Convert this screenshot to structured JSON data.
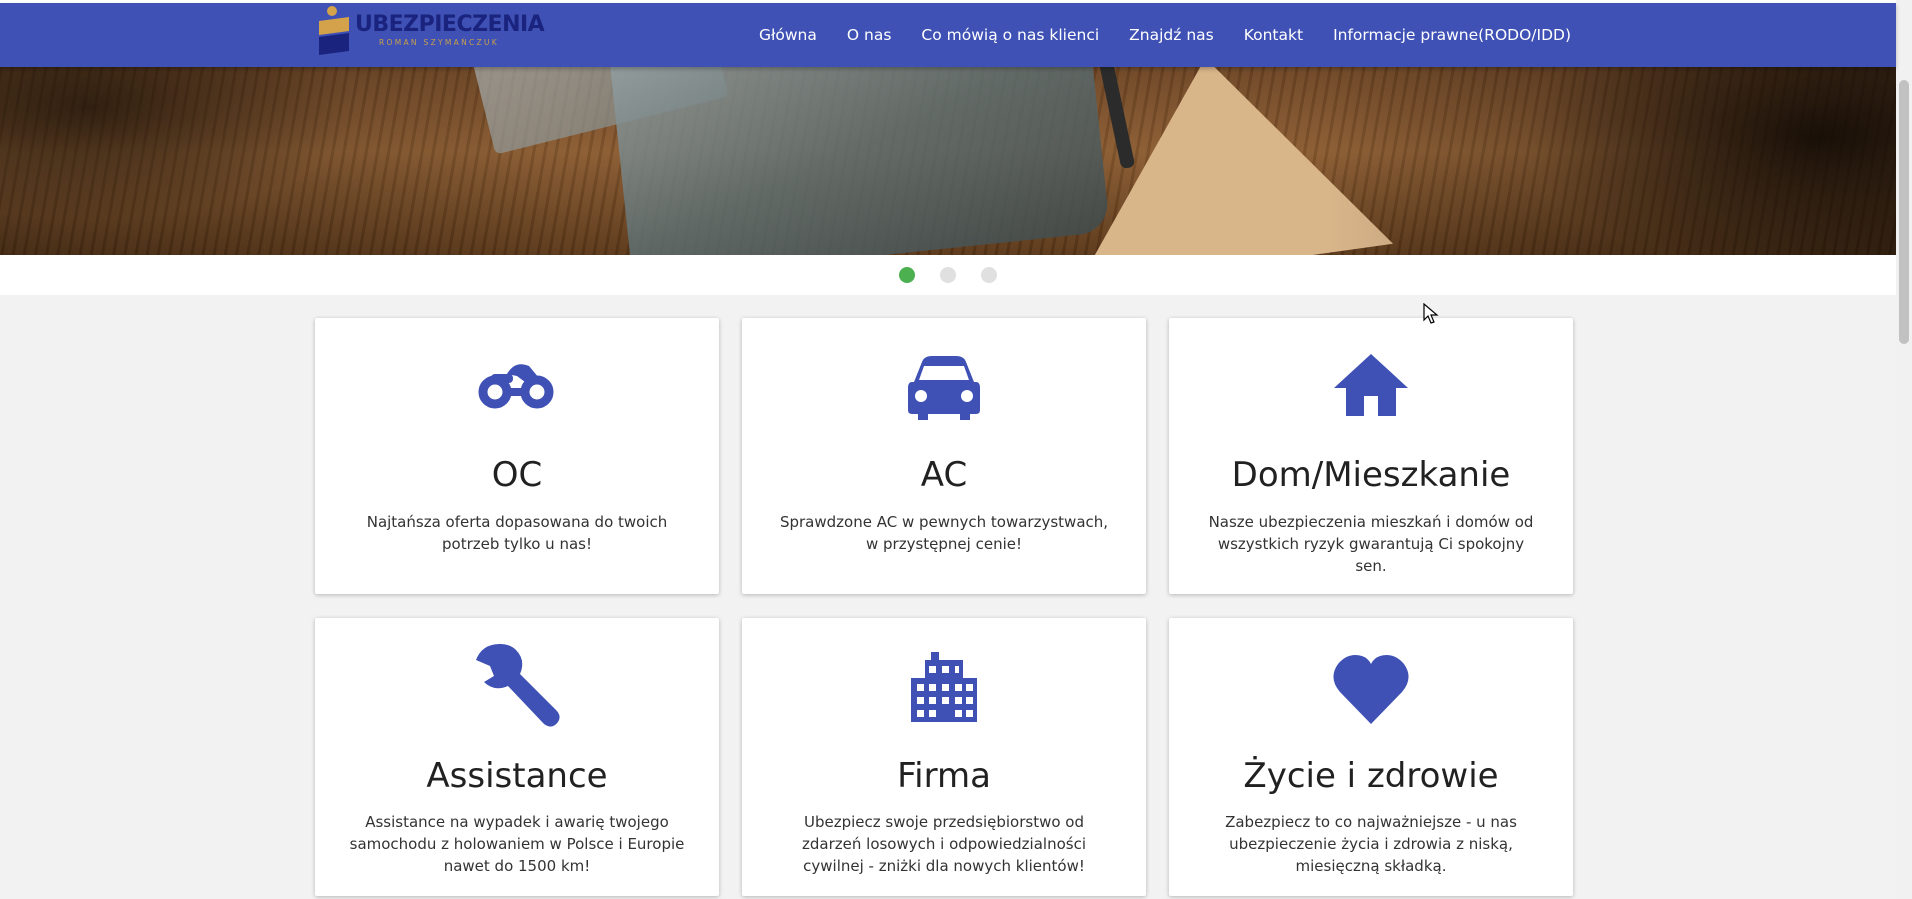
{
  "logo": {
    "name": "UBEZPIECZENIA",
    "subtitle": "ROMAN SZYMAŃCZUK",
    "colors": {
      "primary": "#1a237e",
      "accent": "#d4a24a"
    }
  },
  "nav": {
    "background": "#3f51b5",
    "items": [
      {
        "label": "Główna"
      },
      {
        "label": "O nas"
      },
      {
        "label": "Co mówią o nas klienci"
      },
      {
        "label": "Znajdź nas"
      },
      {
        "label": "Kontakt"
      },
      {
        "label": "Informacje prawne(RODO/IDD)"
      }
    ]
  },
  "carousel": {
    "slides": 3,
    "active_index": 0,
    "colors": {
      "active": "#4caf50",
      "inactive": "#e0e0e0"
    }
  },
  "cards": [
    {
      "icon": "motorcycle-icon",
      "title": "OC",
      "text": "Najtańsza oferta dopasowana do twoich potrzeb tylko u nas!"
    },
    {
      "icon": "car-icon",
      "title": "AC",
      "text": "Sprawdzone AC w pewnych towarzystwach, w przystępnej cenie!"
    },
    {
      "icon": "home-icon",
      "title": "Dom/Mieszkanie",
      "text": "Nasze ubezpieczenia mieszkań i domów od wszystkich ryzyk gwarantują Ci spokojny sen."
    },
    {
      "icon": "wrench-icon",
      "title": "Assistance",
      "text": "Assistance na wypadek i awarię twojego samochodu z holowaniem w Polsce i Europie nawet do 1500 km!"
    },
    {
      "icon": "building-icon",
      "title": "Firma",
      "text": "Ubezpiecz swoje przedsiębiorstwo od zdarzeń losowych i odpowiedzialności cywilnej - zniżki dla nowych klientów!"
    },
    {
      "icon": "heart-icon",
      "title": "Życie i zdrowie",
      "text": "Zabezpiecz to co najważniejsze - u nas ubezpieczenie życia i zdrowia z niską, miesięczną składką."
    }
  ],
  "icon_color": "#3f51b5"
}
